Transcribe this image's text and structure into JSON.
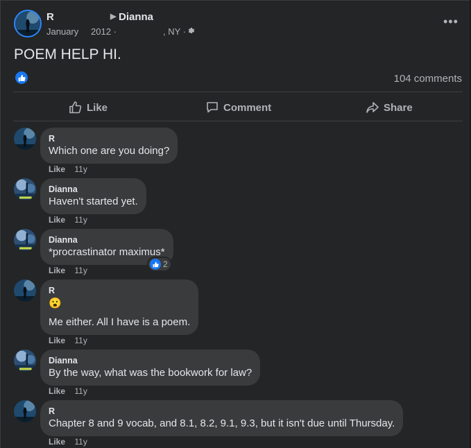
{
  "post": {
    "author": "R",
    "target": "Dianna",
    "meta": {
      "month": "January",
      "year": "2012 ·",
      "location": ", NY ·"
    },
    "title": "POEM HELP HI.",
    "comments_count": "104 comments",
    "reaction_icon": "like-icon"
  },
  "actions": {
    "like": "Like",
    "comment": "Comment",
    "share": "Share"
  },
  "comments": [
    {
      "name": "R",
      "text": "Which one are you doing?",
      "like": "Like",
      "time": "11y"
    },
    {
      "name": "Dianna",
      "text": "Haven't started yet.",
      "like": "Like",
      "time": "11y"
    },
    {
      "name": "Dianna",
      "text": "*procrastinator maximus*",
      "like": "Like",
      "time": "11y",
      "reactions": "2"
    },
    {
      "name": "R",
      "emoji": "😮",
      "text": "Me either. All I have is a poem.",
      "like": "Like",
      "time": "11y"
    },
    {
      "name": "Dianna",
      "text": "By the way, what was the bookwork for law?",
      "like": "Like",
      "time": "11y"
    },
    {
      "name": "R",
      "text": "Chapter 8 and 9 vocab, and 8.1, 8.2, 9.1, 9.3, but it isn't due until Thursday.",
      "like": "Like",
      "time": "11y"
    }
  ],
  "colors": {
    "background": "#18191a",
    "card": "#242526",
    "bubble": "#3a3b3c",
    "accent": "#1877f2",
    "muted": "#b0b3b8"
  }
}
